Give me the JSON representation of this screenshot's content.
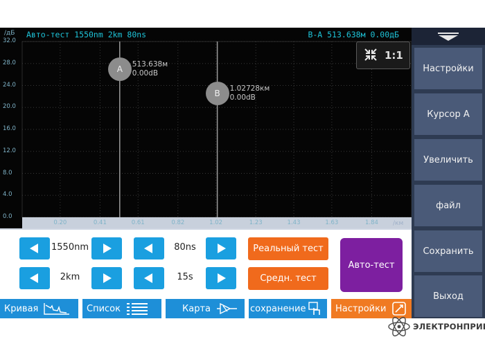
{
  "header": {
    "title": "Авто-тест 1550nm 2km 80ns",
    "delta_readout": "B-A 513.638м 0.00дБ",
    "y_unit": "/дБ",
    "x_unit": "/км"
  },
  "chart_data": {
    "type": "line",
    "ylabel": "/дБ",
    "xlabel": "/км",
    "ylim": [
      0,
      32
    ],
    "xlim": [
      0,
      2.05
    ],
    "y_ticks": [
      "32.0",
      "28.0",
      "24.0",
      "20.0",
      "16.0",
      "12.0",
      "8.0",
      "4.0",
      "0.0"
    ],
    "x_ticks": [
      "0.20",
      "0.41",
      "0.61",
      "0.82",
      "1.02",
      "1.23",
      "1.43",
      "1.63",
      "1.84"
    ],
    "grid": true,
    "series": [],
    "cursors": [
      {
        "label": "A",
        "x_km": 0.5136,
        "y_db": 27,
        "readout_distance": "513.638м",
        "readout_loss": "0.00dB"
      },
      {
        "label": "B",
        "x_km": 1.02728,
        "y_db": 22.5,
        "readout_distance": "1.02728км",
        "readout_loss": "0.00dB"
      }
    ]
  },
  "zoom": {
    "label": "1:1",
    "icon": "fit-zoom-icon"
  },
  "sidebar": {
    "items": [
      {
        "label": "Настройки"
      },
      {
        "label": "Курсор A"
      },
      {
        "label": "Увеличить"
      },
      {
        "label": "файл"
      },
      {
        "label": "Сохранить"
      },
      {
        "label": "Выход"
      }
    ]
  },
  "controls": {
    "wavelength": "1550nm",
    "range": "2km",
    "pulse_width": "80ns",
    "duration": "15s",
    "realtime_test": "Реальный тест",
    "average_test": "Средн. тест",
    "auto_test": "Авто-тест"
  },
  "tabs": [
    {
      "label": "Кривая",
      "icon": "trace-icon"
    },
    {
      "label": "Список",
      "icon": "list-icon"
    },
    {
      "label": "Карта",
      "icon": "map-icon"
    },
    {
      "label": "сохранение",
      "icon": "save-touch-icon"
    },
    {
      "label": "Настройки",
      "icon": "settings-icon"
    }
  ],
  "watermark": {
    "text": "ЭЛЕКТРОНПРИБОР"
  },
  "colors": {
    "accent_blue": "#1a9fe0",
    "accent_orange": "#f06a1c",
    "accent_purple": "#7d1fa0",
    "readout_cyan": "#1ec3d8",
    "sidebar_button": "#4a5a78"
  }
}
